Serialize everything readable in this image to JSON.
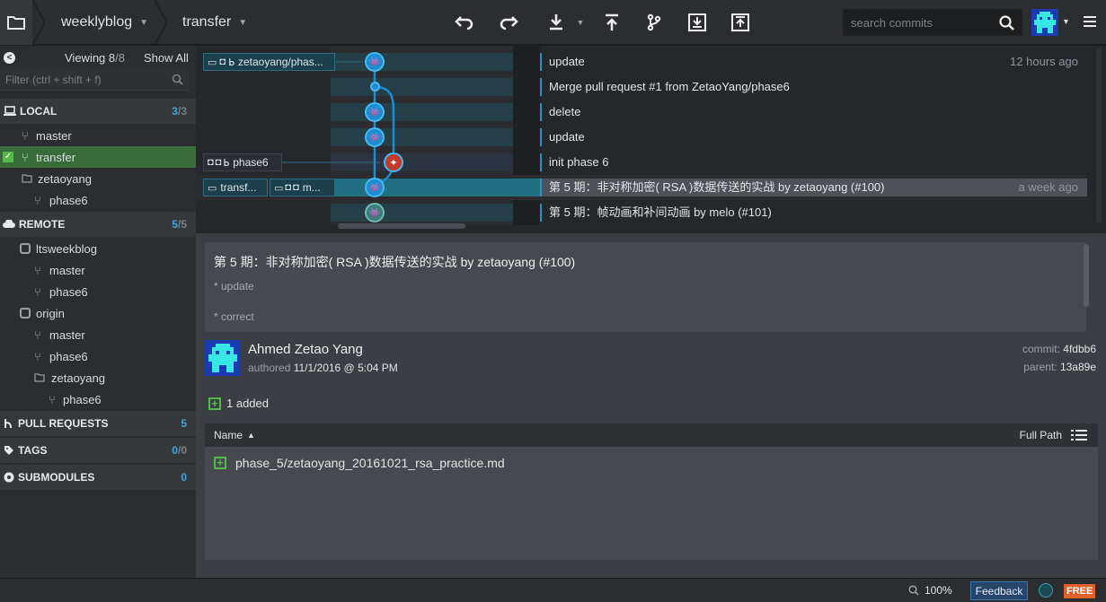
{
  "toolbar": {
    "repo": "weeklyblog",
    "branch": "transfer",
    "search_placeholder": "search commits",
    "actions": [
      "undo",
      "redo",
      "pull",
      "push",
      "branch",
      "stash",
      "pop"
    ]
  },
  "sidebar": {
    "viewing_label": "Viewing",
    "viewing_count": "8",
    "viewing_total": "/8",
    "show_all": "Show All",
    "filter_placeholder": "Filter (ctrl + shift + f)",
    "local": {
      "title": "LOCAL",
      "count": "3",
      "total": "/3",
      "items": [
        "master",
        "transfer",
        "zetaoyang",
        "phase6"
      ]
    },
    "remote": {
      "title": "REMOTE",
      "count": "5",
      "total": "/5",
      "items": [
        "ltsweekblog",
        "master",
        "phase6",
        "origin",
        "master",
        "phase6",
        "zetaoyang",
        "phase6"
      ]
    },
    "pull_requests": {
      "title": "PULL REQUESTS",
      "count": "5"
    },
    "tags": {
      "title": "TAGS",
      "count": "0",
      "total": "/0"
    },
    "submodules": {
      "title": "SUBMODULES",
      "count": "0"
    }
  },
  "graph": {
    "tags": {
      "row0": "zetaoyang/phas...",
      "row4": "phase6",
      "row5a": "transf...",
      "row5b": "m..."
    },
    "commits": [
      {
        "msg": "update",
        "time": "12 hours ago"
      },
      {
        "msg": "Merge pull request #1 from ZetaoYang/phase6",
        "time": ""
      },
      {
        "msg": "delete",
        "time": ""
      },
      {
        "msg": "update",
        "time": ""
      },
      {
        "msg": "init phase 6",
        "time": ""
      },
      {
        "msg": "第 5 期：非对称加密( RSA )数据传送的实战 by zetaoyang (#100)",
        "time": "a week ago"
      },
      {
        "msg": "第 5 期：帧动画和补间动画 by melo (#101)",
        "time": ""
      }
    ]
  },
  "detail": {
    "title": "第 5 期：非对称加密( RSA )数据传送的实战 by zetaoyang (#100)",
    "body_lines": [
      "* update",
      "* correct"
    ],
    "author": "Ahmed Zetao Yang",
    "authored_label": "authored",
    "authored_date": "11/1/2016 @ 5:04 PM",
    "commit_label": "commit:",
    "commit_sha": "4fdbb6",
    "parent_label": "parent:",
    "parent_sha": "13a89e",
    "added_label": "1 added",
    "files_col_name": "Name",
    "files_full_path": "Full Path",
    "files": [
      "phase_5/zetaoyang_20161021_rsa_practice.md"
    ]
  },
  "status": {
    "zoom": "100%",
    "feedback": "Feedback",
    "free": "FREE"
  },
  "colors": {
    "accent": "#3ea7dd",
    "selected_branch": "#3a6b3a",
    "added": "#55b84a",
    "free": "#e0602a"
  }
}
